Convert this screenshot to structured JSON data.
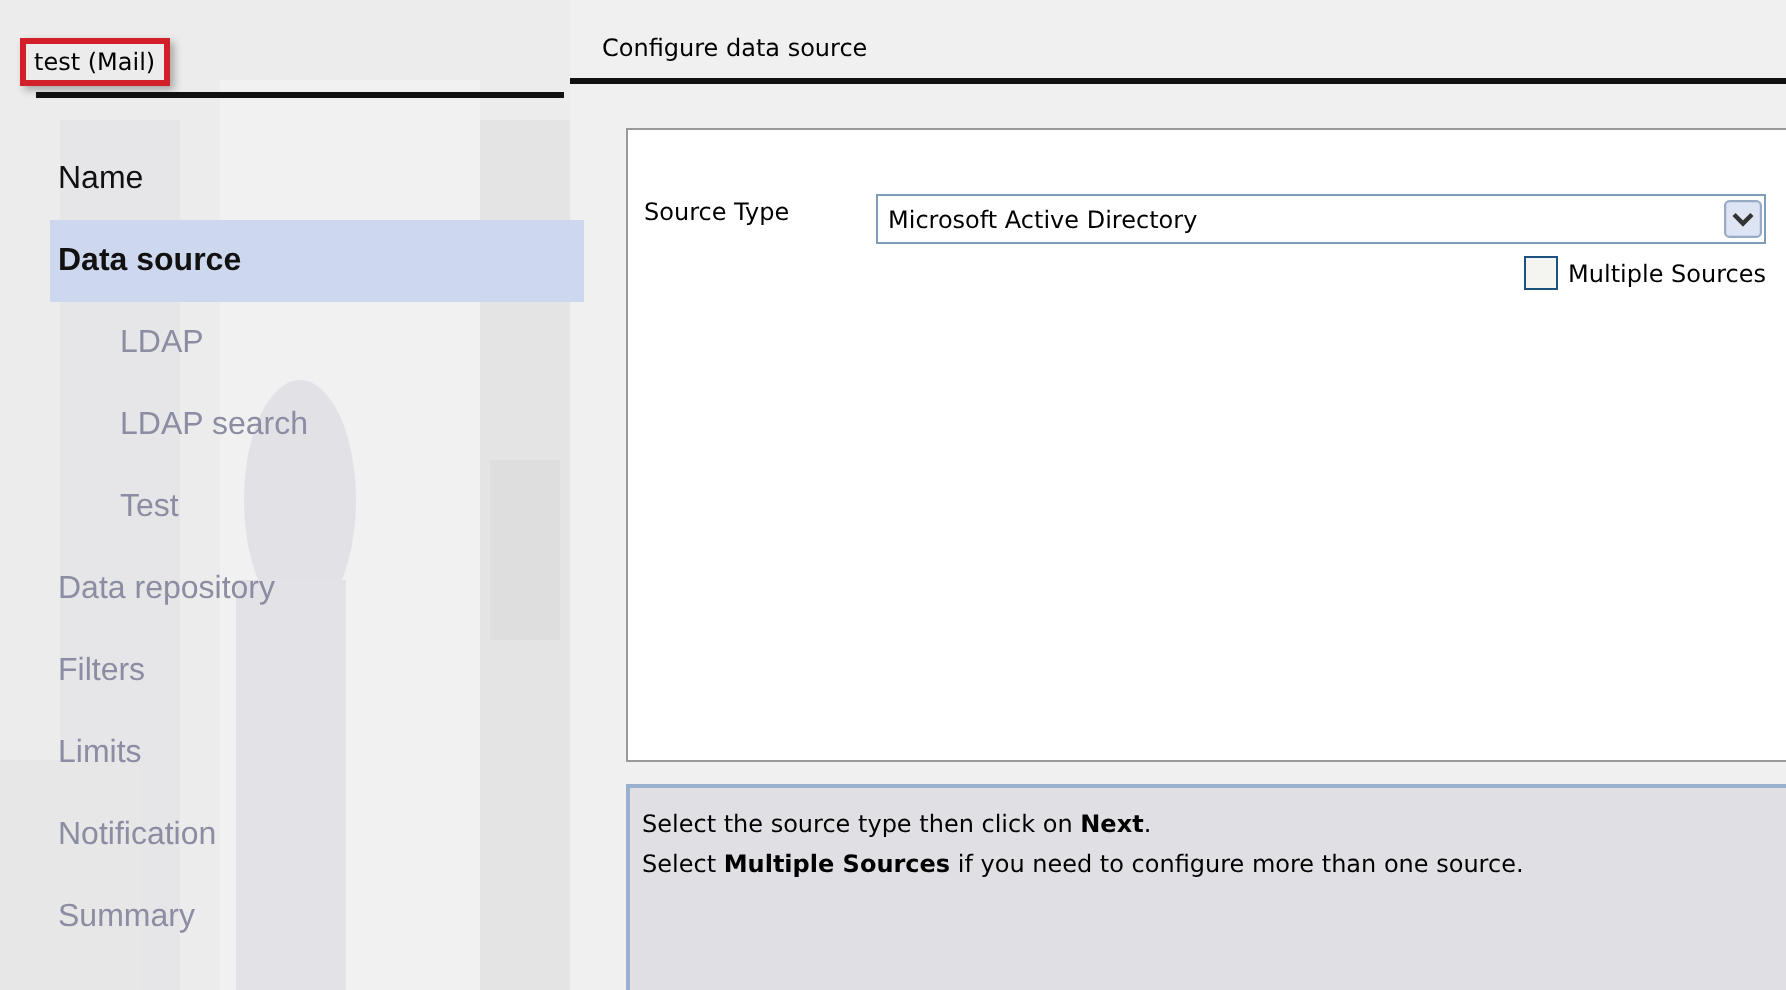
{
  "wizard_title": {
    "text": "test (Mail)",
    "highlighted": true
  },
  "steps": [
    {
      "label": "Name",
      "selected": false,
      "disabled": false
    },
    {
      "label": "Data source",
      "selected": true,
      "disabled": false,
      "children": [
        {
          "label": "LDAP",
          "selected": false,
          "disabled": true
        },
        {
          "label": "LDAP search",
          "selected": false,
          "disabled": true
        },
        {
          "label": "Test",
          "selected": false,
          "disabled": true
        }
      ]
    },
    {
      "label": "Data repository",
      "selected": false,
      "disabled": true
    },
    {
      "label": "Filters",
      "selected": false,
      "disabled": true
    },
    {
      "label": "Limits",
      "selected": false,
      "disabled": true
    },
    {
      "label": "Notification",
      "selected": false,
      "disabled": true
    },
    {
      "label": "Summary",
      "selected": false,
      "disabled": true
    }
  ],
  "page_title": "Configure data source",
  "form": {
    "source_type_label": "Source Type",
    "source_type_value": "Microsoft Active Directory",
    "multiple_sources": {
      "label": "Multiple Sources",
      "checked": false
    }
  },
  "help": [
    "Select the source type then click on **Next**.",
    "Select **Multiple Sources** if you need to configure more than one source."
  ]
}
